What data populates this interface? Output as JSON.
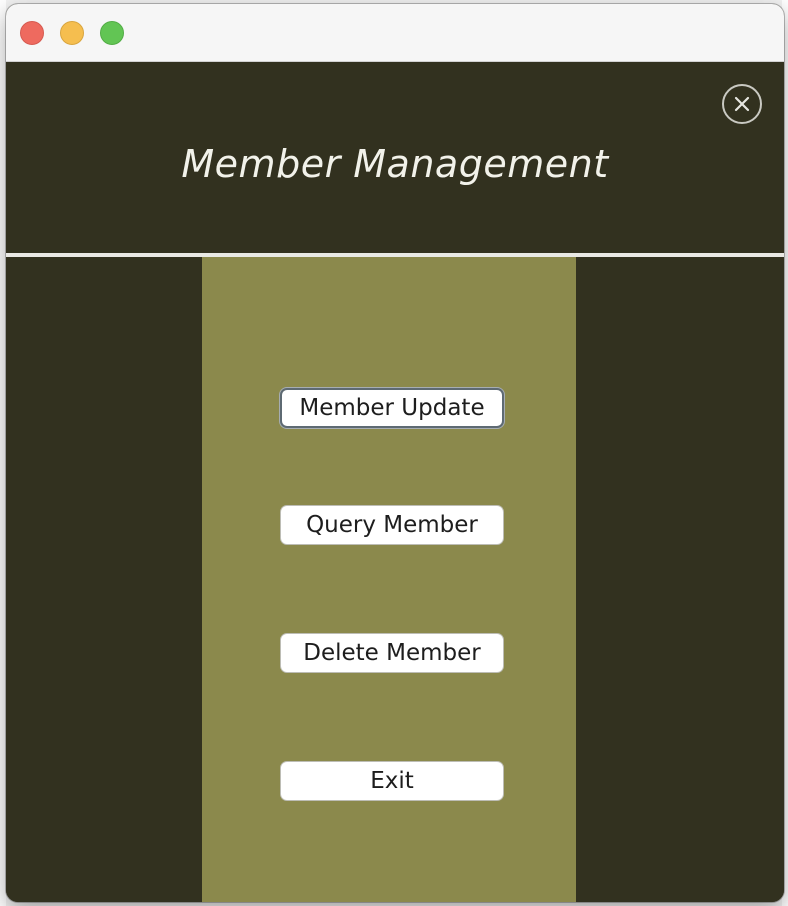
{
  "window": {
    "traffic_lights": [
      "close",
      "minimize",
      "maximize"
    ]
  },
  "header": {
    "title": "Member Management",
    "close_icon": "close-circle-icon"
  },
  "menu": {
    "buttons": [
      {
        "label": "Member Update",
        "focused": true
      },
      {
        "label": "Query Member",
        "focused": false
      },
      {
        "label": "Delete Member",
        "focused": false
      },
      {
        "label": "Exit",
        "focused": false
      }
    ]
  },
  "colors": {
    "background_dark": "#32311f",
    "center_panel": "#8b894c",
    "title_text": "#f2f2ea",
    "button_bg": "#ffffff"
  }
}
